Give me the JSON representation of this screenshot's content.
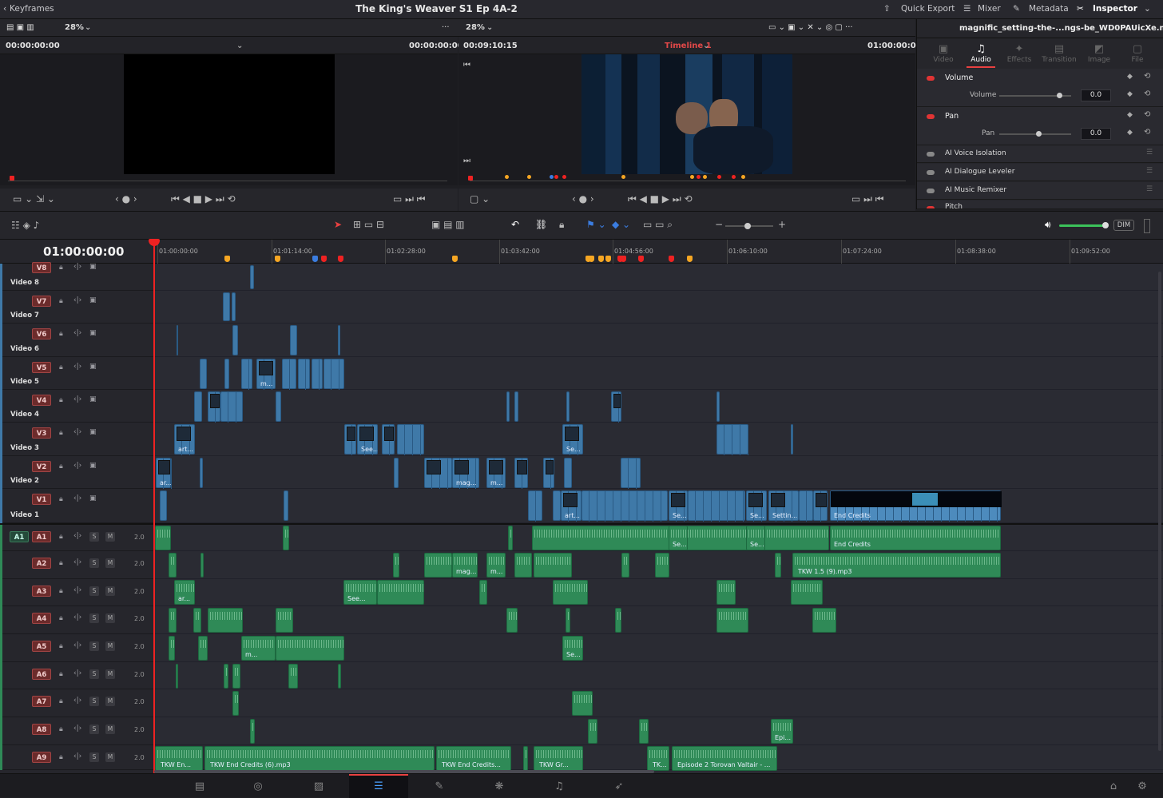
{
  "topbar": {
    "left_label": "Keyframes",
    "project_title": "The King's Weaver S1 Ep 4A-2",
    "quick_export": "Quick Export",
    "mixer": "Mixer",
    "metadata": "Metadata",
    "inspector": "Inspector"
  },
  "source_viewer": {
    "zoom": "28%",
    "timecode_left": "00:00:00:00",
    "timecode_right": "00:00:00:00"
  },
  "timeline_viewer": {
    "zoom": "28%",
    "timecode_left": "00:09:10:15",
    "timeline_name": "Timeline 1",
    "timecode_right": "01:00:00:00"
  },
  "inspector": {
    "clip_name": "magnific_setting-the-...ngs-be_WD0PAUicXe.mp4",
    "tabs": [
      {
        "label": "Video",
        "glyph": "▣"
      },
      {
        "label": "Audio",
        "glyph": "♫"
      },
      {
        "label": "Effects",
        "glyph": "✦"
      },
      {
        "label": "Transition",
        "glyph": "▤"
      },
      {
        "label": "Image",
        "glyph": "◩"
      },
      {
        "label": "File",
        "glyph": "▢"
      }
    ],
    "volume_section": "Volume",
    "volume_label": "Volume",
    "volume_value": "0.0",
    "pan_section": "Pan",
    "pan_label": "Pan",
    "pan_value": "0.0",
    "fx": [
      "AI Voice Isolation",
      "AI Dialogue Leveler",
      "AI Music Remixer",
      "Pitch"
    ]
  },
  "toolbar": {
    "dim": "DIM"
  },
  "timeline": {
    "current_tc": "01:00:00:00",
    "ticks": [
      "01:00:00:00",
      "01:01:14:00",
      "01:02:28:00",
      "01:03:42:00",
      "01:04:56:00",
      "01:06:10:00",
      "01:07:24:00",
      "01:08:38:00",
      "01:09:52:00"
    ],
    "video_tracks": [
      {
        "badge": "V8",
        "name": "Video 8"
      },
      {
        "badge": "V7",
        "name": "Video 7"
      },
      {
        "badge": "V6",
        "name": "Video 6"
      },
      {
        "badge": "V5",
        "name": "Video 5"
      },
      {
        "badge": "V4",
        "name": "Video 4"
      },
      {
        "badge": "V3",
        "name": "Video 3"
      },
      {
        "badge": "V2",
        "name": "Video 2"
      },
      {
        "badge": "V1",
        "name": "Video 1"
      }
    ],
    "audio_tracks": [
      {
        "badge": "A1",
        "vol": "2.0"
      },
      {
        "badge": "A2",
        "vol": "2.0"
      },
      {
        "badge": "A3",
        "vol": "2.0"
      },
      {
        "badge": "A4",
        "vol": "2.0"
      },
      {
        "badge": "A5",
        "vol": "2.0"
      },
      {
        "badge": "A6",
        "vol": "2.0"
      },
      {
        "badge": "A7",
        "vol": "2.0"
      },
      {
        "badge": "A8",
        "vol": "2.0"
      },
      {
        "badge": "A9",
        "vol": "2.0"
      }
    ],
    "audio_master": "A1",
    "solo": "S",
    "mute": "M",
    "clip_labels": {
      "v5": "m...",
      "v3a": "art...",
      "v3b": "See...",
      "v3c": "Se...",
      "v2a": "ar...",
      "v2b": "mag...",
      "v2c": "m...",
      "v1a": "art...",
      "v1b": "Se...",
      "v1c": "Se...",
      "v1d": "Settin...",
      "end_credits": "End Credits",
      "a1a": "Se...",
      "a1b": "Se...",
      "a1_end": "End Credits",
      "a2a": "mag...",
      "a2b": "m...",
      "a2_mp3": "TKW 1.5 (9).mp3",
      "a3a": "ar...",
      "a3b": "See...",
      "a5a": "m...",
      "a5b": "Se...",
      "a8": "Epi...",
      "a9a": "TKW En...",
      "a9b": "TKW End Credits (6).mp3",
      "a9c": "TKW End Credits...",
      "a9d": "TKW Gr...",
      "a9e": "TK...",
      "a9f": "Episode 2 Torovan Valtair - ..."
    }
  }
}
